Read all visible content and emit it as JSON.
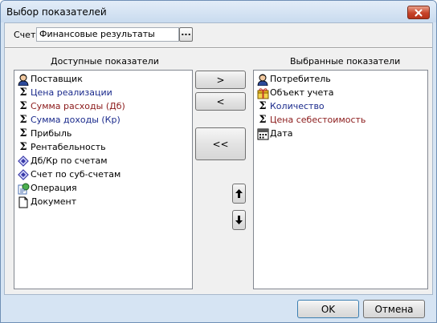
{
  "window": {
    "title": "Выбор показателей",
    "close_label": "Закрыть"
  },
  "account": {
    "label": "Счет",
    "value": "Финансовые результаты",
    "browse_label": "..."
  },
  "available": {
    "heading": "Доступные показатели",
    "items": [
      {
        "label": "Поставщик",
        "icon": "person-icon",
        "color": "#000000"
      },
      {
        "label": "Цена реализации",
        "icon": "sigma-icon",
        "color": "#1a2a8c"
      },
      {
        "label": "Сумма расходы (Дб)",
        "icon": "sigma-icon",
        "color": "#8b1a1a"
      },
      {
        "label": "Сумма доходы (Кр)",
        "icon": "sigma-icon",
        "color": "#1a2a8c"
      },
      {
        "label": "Прибыль",
        "icon": "sigma-icon",
        "color": "#000000"
      },
      {
        "label": "Рентабельность",
        "icon": "sigma-icon",
        "color": "#000000"
      },
      {
        "label": "Дб/Кр по счетам",
        "icon": "diamond-icon",
        "color": "#000000"
      },
      {
        "label": "Счет по суб-счетам",
        "icon": "diamond-icon",
        "color": "#000000"
      },
      {
        "label": "Операция",
        "icon": "operation-icon",
        "color": "#000000"
      },
      {
        "label": "Документ",
        "icon": "document-icon",
        "color": "#000000"
      }
    ]
  },
  "selected": {
    "heading": "Выбранные показатели",
    "items": [
      {
        "label": "Потребитель",
        "icon": "person-icon",
        "color": "#000000"
      },
      {
        "label": "Объект учета",
        "icon": "gift-icon",
        "color": "#000000"
      },
      {
        "label": "Количество",
        "icon": "sigma-icon",
        "color": "#1a2a8c"
      },
      {
        "label": "Цена себестоимость",
        "icon": "sigma-icon",
        "color": "#8b1a1a"
      },
      {
        "label": "Дата",
        "icon": "calendar-icon",
        "color": "#000000"
      }
    ]
  },
  "transfer": {
    "add": ">",
    "remove": "<",
    "remove_all": "<<"
  },
  "footer": {
    "ok": "OK",
    "cancel": "Отмена"
  }
}
